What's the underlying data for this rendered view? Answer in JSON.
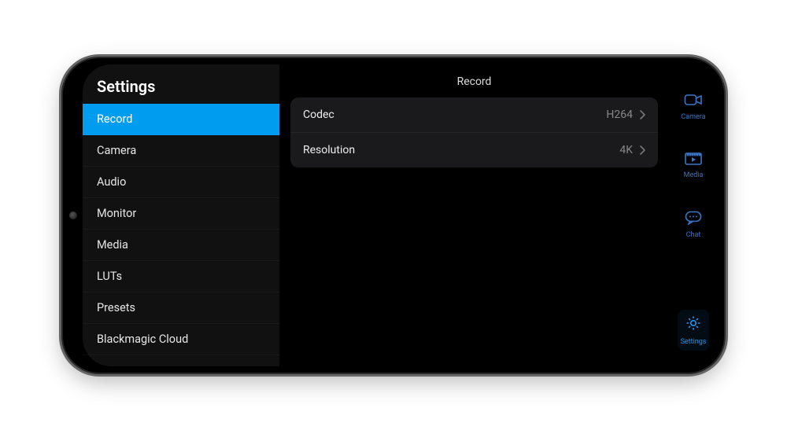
{
  "colors": {
    "accent": "#009cf0",
    "nav": "#3a75c4",
    "navActive": "#2196f3",
    "panel": "#1a1a1c",
    "sidebar": "#111111"
  },
  "sidebar": {
    "title": "Settings",
    "items": [
      {
        "label": "Record",
        "active": true
      },
      {
        "label": "Camera",
        "active": false
      },
      {
        "label": "Audio",
        "active": false
      },
      {
        "label": "Monitor",
        "active": false
      },
      {
        "label": "Media",
        "active": false
      },
      {
        "label": "LUTs",
        "active": false
      },
      {
        "label": "Presets",
        "active": false
      },
      {
        "label": "Blackmagic Cloud",
        "active": false
      }
    ]
  },
  "content": {
    "title": "Record",
    "rows": [
      {
        "label": "Codec",
        "value": "H264"
      },
      {
        "label": "Resolution",
        "value": "4K"
      }
    ]
  },
  "nav": {
    "items": [
      {
        "label": "Camera",
        "icon": "camera-icon",
        "active": false
      },
      {
        "label": "Media",
        "icon": "media-icon",
        "active": false
      },
      {
        "label": "Chat",
        "icon": "chat-icon",
        "active": false
      },
      {
        "label": "Settings",
        "icon": "gear-icon",
        "active": true
      }
    ]
  }
}
